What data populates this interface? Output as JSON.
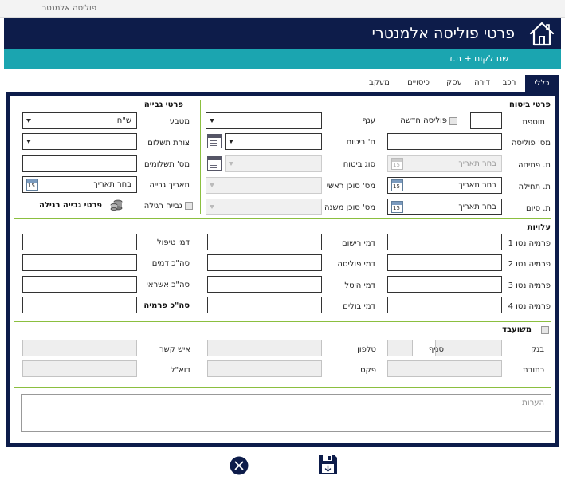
{
  "window": {
    "title": "פוליסה אלמנטרי"
  },
  "header": {
    "title": "פרטי פוליסה אלמנטרי",
    "subtitle": "שם לקוח + ת.ז"
  },
  "tabs": [
    {
      "label": "כללי",
      "active": true
    },
    {
      "label": "רכב"
    },
    {
      "label": "דירה"
    },
    {
      "label": "עסק"
    },
    {
      "label": "כיסויים"
    },
    {
      "label": "מעקב"
    }
  ],
  "insurance": {
    "title": "פרטי ביטוח",
    "addition_label": "תוספת",
    "new_policy_label": "פוליסה חדשה",
    "branch_label": "ענף",
    "policy_no_label": "מס' פוליסה",
    "company_label": "ח' ביטוח",
    "opening_date_label": "ת. פתיחה",
    "opening_date_placeholder": "בחר תאריך",
    "insurance_type_label": "סוג ביטוח",
    "start_date_label": "ת. תחילה",
    "start_date_value": "בחר תאריך",
    "main_agent_label": "מס' סוכן ראשי",
    "end_date_label": "ת. סיום",
    "end_date_value": "בחר תאריך",
    "sub_agent_label": "מס' סוכן משנה"
  },
  "collection": {
    "title": "פרטי גבייה",
    "currency_label": "מטבע",
    "currency_value": "ש\"ח",
    "payment_method_label": "צורת תשלום",
    "payments_count_label": "מס' תשלומים",
    "collection_date_label": "תאריך גבייה",
    "collection_date_value": "בחר תאריך",
    "regular_collection_label": "גבייה רגילה",
    "regular_collection_details": "פרטי גבייה רגילה"
  },
  "costs": {
    "title": "עלויות",
    "net_premium_1": "פרמיה נטו 1",
    "net_premium_2": "פרמיה נטו 2",
    "net_premium_3": "פרמיה נטו 3",
    "net_premium_4": "פרמיה נטו 4",
    "registration_fee": "דמי רישום",
    "policy_fee": "דמי פוליסה",
    "handling_surcharge": "דמי היטל",
    "stamp_fee": "דמי בולים",
    "handling_fee": "דמי טיפול",
    "total_fees": "סה\"כ דמים",
    "total_credit": "סה\"כ אשראי",
    "total_premium": "סה\"כ פרמיה"
  },
  "pledged": {
    "title": "משועבד",
    "bank_label": "בנק",
    "branch_label": "סניף",
    "phone_label": "טלפון",
    "contact_label": "איש קשר",
    "address_label": "כתובת",
    "fax_label": "פקס",
    "email_label": "דוא\"ל"
  },
  "notes": {
    "placeholder": "הערות"
  },
  "colors": {
    "navy": "#0d1c4a",
    "teal": "#1ba5b0",
    "green_divider": "#8bbf3f"
  },
  "icons": {
    "home": "home-icon",
    "calendar": "calendar-icon",
    "window": "window-icon",
    "coins": "coins-icon",
    "close": "close-icon",
    "save": "save-icon",
    "dropdown": "chevron-down-icon"
  }
}
